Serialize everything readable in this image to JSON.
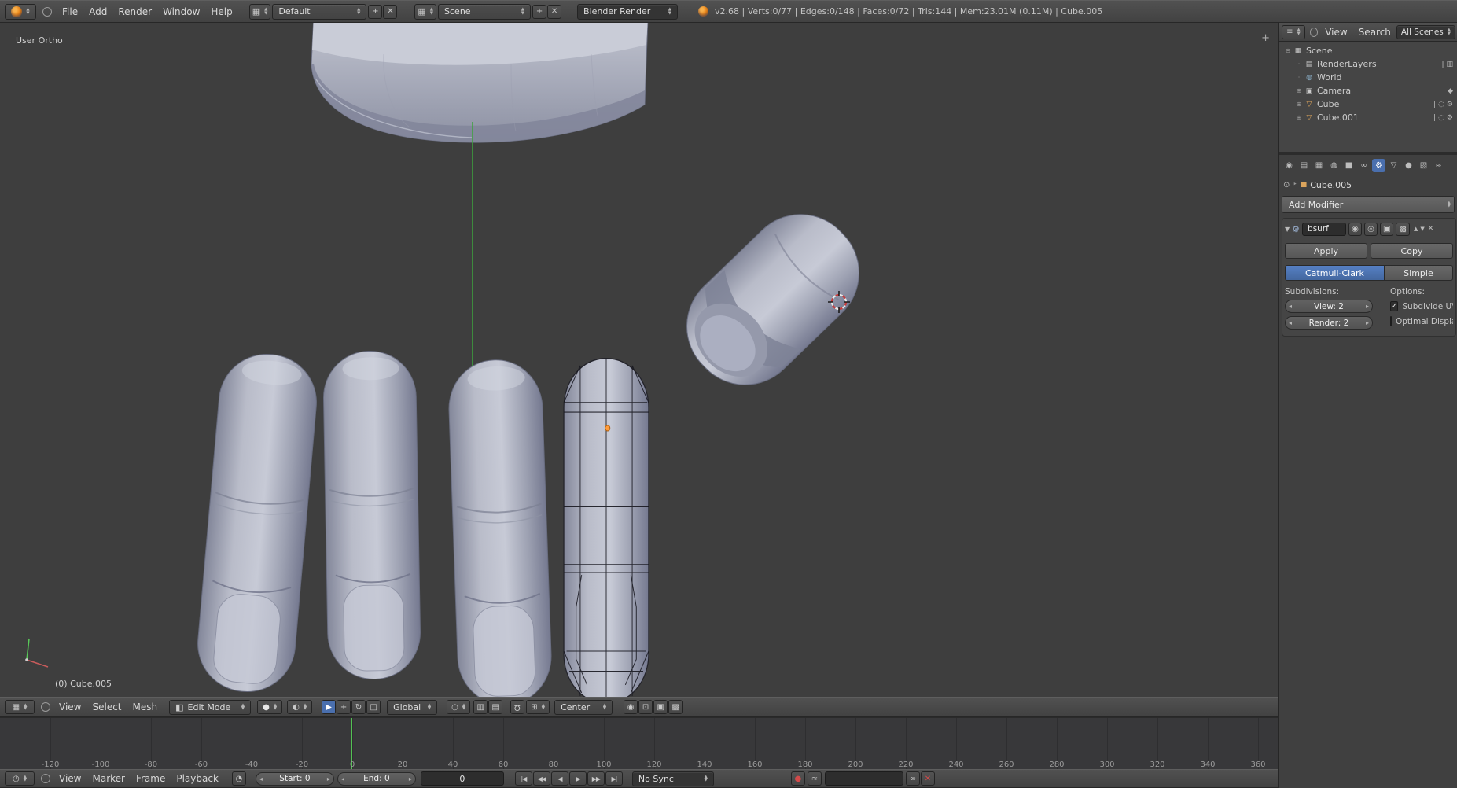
{
  "top_header": {
    "menus": [
      "File",
      "Add",
      "Render",
      "Window",
      "Help"
    ],
    "layout_value": "Default",
    "scene_value": "Scene",
    "engine_value": "Blender Render",
    "stats": "v2.68 | Verts:0/77 | Edges:0/148 | Faces:0/72 | Tris:144 | Mem:23.01M (0.11M) | Cube.005"
  },
  "viewport": {
    "view_label": "User Ortho",
    "active_object_label": "(0) Cube.005"
  },
  "outliner": {
    "menus": [
      "View",
      "Search"
    ],
    "display_mode": "All Scenes",
    "items": [
      {
        "label": "Scene",
        "level": 0,
        "icon": "scene-icon",
        "glyph": "▦",
        "expand": "⊖",
        "right_icons": []
      },
      {
        "label": "RenderLayers",
        "level": 1,
        "icon": "renderlayers-icon",
        "glyph": "▤",
        "expand": "·",
        "right_icons": [
          {
            "name": "renders-icon",
            "glyph": "▥"
          }
        ]
      },
      {
        "label": "World",
        "level": 1,
        "icon": "world-icon",
        "glyph": "◍",
        "expand": "·",
        "right_icons": []
      },
      {
        "label": "Camera",
        "level": 1,
        "icon": "camera-icon",
        "glyph": "▣",
        "expand": "⊕",
        "right_icons": [
          {
            "name": "camera-data-icon",
            "glyph": "◆"
          }
        ]
      },
      {
        "label": "Cube",
        "level": 1,
        "icon": "mesh-icon",
        "glyph": "▽",
        "expand": "⊕",
        "right_icons": [
          {
            "name": "vertex-icon",
            "glyph": "◌"
          },
          {
            "name": "wrench-icon",
            "glyph": "⚙"
          }
        ]
      },
      {
        "label": "Cube.001",
        "level": 1,
        "icon": "mesh-icon",
        "glyph": "▽",
        "expand": "⊕",
        "right_icons": [
          {
            "name": "vertex-icon",
            "glyph": "◌"
          },
          {
            "name": "wrench-icon",
            "glyph": "⚙"
          }
        ]
      }
    ]
  },
  "properties": {
    "tabs": [
      {
        "name": "tab-render",
        "glyph": "◉",
        "active": false
      },
      {
        "name": "tab-render-layers",
        "glyph": "▤",
        "active": false
      },
      {
        "name": "tab-scene",
        "glyph": "▦",
        "active": false
      },
      {
        "name": "tab-world",
        "glyph": "◍",
        "active": false
      },
      {
        "name": "tab-object",
        "glyph": "■",
        "active": false
      },
      {
        "name": "tab-constraints",
        "glyph": "∞",
        "active": false
      },
      {
        "name": "tab-modifiers",
        "glyph": "⚙",
        "active": true
      },
      {
        "name": "tab-data",
        "glyph": "▽",
        "active": false
      },
      {
        "name": "tab-material",
        "glyph": "●",
        "active": false
      },
      {
        "name": "tab-texture",
        "glyph": "▨",
        "active": false
      },
      {
        "name": "tab-physics",
        "glyph": "≈",
        "active": false
      }
    ],
    "breadcrumb_object": "Cube.005",
    "add_modifier_label": "Add Modifier",
    "modifier": {
      "name_value": "bsurf",
      "apply_label": "Apply",
      "copy_label": "Copy",
      "type_selected": "Catmull-Clark",
      "type_other": "Simple",
      "subdivisions_label": "Subdivisions:",
      "options_label": "Options:",
      "view_value": "View: 2",
      "render_value": "Render: 2",
      "subdivide_uvs_label": "Subdivide UVs",
      "subdivide_uvs_checked": true,
      "optimal_display_label": "Optimal Display",
      "optimal_display_checked": false
    }
  },
  "view3d_header": {
    "menus": [
      "View",
      "Select",
      "Mesh"
    ],
    "mode_value": "Edit Mode",
    "orientation_value": "Global",
    "snap_target_value": "Center"
  },
  "timeline": {
    "ruler_ticks": [
      -120,
      -100,
      -80,
      -60,
      -40,
      -20,
      0,
      20,
      40,
      60,
      80,
      100,
      120,
      140,
      160,
      180,
      200,
      220,
      240,
      260,
      280,
      300,
      320,
      340,
      360
    ],
    "current_frame": 0,
    "menus": [
      "View",
      "Marker",
      "Frame",
      "Playback"
    ],
    "start_value": "Start: 0",
    "end_value": "End: 0",
    "frame_value": "0",
    "sync_value": "No Sync",
    "playback_buttons": [
      {
        "name": "jump-start-button",
        "glyph": "|◀"
      },
      {
        "name": "prev-keyframe-button",
        "glyph": "◀◀"
      },
      {
        "name": "play-reverse-button",
        "glyph": "◀"
      },
      {
        "name": "play-button",
        "glyph": "▶"
      },
      {
        "name": "next-keyframe-button",
        "glyph": "▶▶"
      },
      {
        "name": "jump-end-button",
        "glyph": "▶|"
      }
    ]
  },
  "icons": {
    "add": "+",
    "close": "✕",
    "check": "✓",
    "magnet": "Ω",
    "grid": "▦",
    "list": "≡",
    "sphere": "●",
    "half_sphere": "◐",
    "clock": "◷",
    "clock_small": "◔",
    "record": "●",
    "pulse": "≈",
    "link": "∞",
    "pin": "⊙",
    "cube": "■",
    "camera": "◉",
    "eye": "◎",
    "editbox": "▣",
    "cage": "▩",
    "wrench": "⚙",
    "crumb_sep": "‣",
    "collapse": "▼",
    "mesh_tri": "▽",
    "mode_icon": "◧",
    "prop_circle": "○",
    "snap_el": "⊞",
    "manip_move": "+",
    "manip_rotate": "↻",
    "manip_scale": "□",
    "manip_axis": "▶",
    "occlude": "▥",
    "shade1": "◉",
    "shade2": "⊡",
    "shade3": "▤",
    "region_plus": "+"
  },
  "colors": {
    "accent_blue": "#4a6fae",
    "frame_green": "#53c153",
    "mesh_orange": "#dba45c",
    "world_blue": "#8fb6d0"
  }
}
